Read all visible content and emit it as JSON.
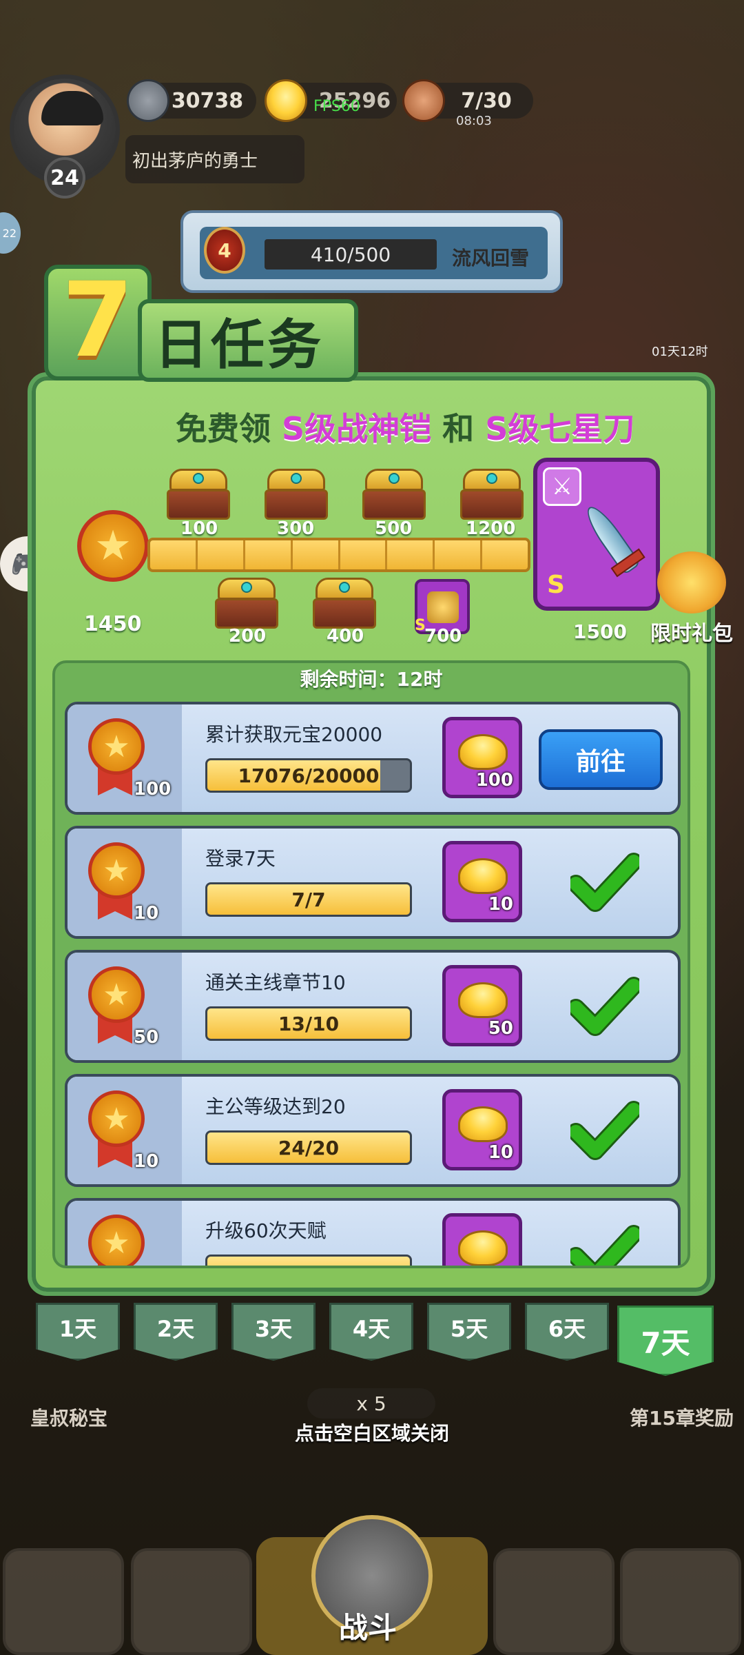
{
  "hud": {
    "level": "24",
    "title": "初出茅庐的勇士",
    "coins": "30738",
    "gold": "25296",
    "fps": "FPS60",
    "stamina": "7/30",
    "stamina_timer": "08:03",
    "side_badge": "22"
  },
  "event": {
    "level": "4",
    "progress": "410/500",
    "name": "流风回雪",
    "side_timer": "01天12时"
  },
  "modal": {
    "title_number": "7",
    "title_text": "日任务",
    "promo_prefix": "免费领",
    "promo_item1": "S级战神铠",
    "promo_and": "和",
    "promo_item2": "S级七星刀",
    "points_total": "1450",
    "milestones_top": [
      "100",
      "300",
      "500",
      "1200"
    ],
    "milestones_bottom": [
      "200",
      "400",
      "700"
    ],
    "milestone_grade_small": "S",
    "big_reward_grade": "S",
    "big_reward_value": "1500",
    "gift_label": "限时礼包",
    "remaining": "剩余时间：12时"
  },
  "tasks": [
    {
      "name": "累计获取元宝20000",
      "progress": "17076/20000",
      "progress_fraction": 0.8538,
      "points": "100",
      "reward": "100",
      "state": "go",
      "button_label": "前往"
    },
    {
      "name": "登录7天",
      "progress": "7/7",
      "progress_fraction": 1.0,
      "points": "10",
      "reward": "10",
      "state": "done"
    },
    {
      "name": "通关主线章节10",
      "progress": "13/10",
      "progress_fraction": 1.0,
      "points": "50",
      "reward": "50",
      "state": "done"
    },
    {
      "name": "主公等级达到20",
      "progress": "24/20",
      "progress_fraction": 1.0,
      "points": "10",
      "reward": "10",
      "state": "done"
    },
    {
      "name": "升级60次天赋",
      "progress": "",
      "progress_fraction": 1.0,
      "points": "",
      "reward": "",
      "state": "done"
    }
  ],
  "days": [
    "1天",
    "2天",
    "3天",
    "4天",
    "5天",
    "6天",
    "7天"
  ],
  "active_day": "7天",
  "background": {
    "left_label": "皇叔秘宝",
    "right_label": "第15章奖励",
    "battle_cost": "x 5",
    "close_hint": "点击空白区域关闭",
    "battle_label": "战斗"
  },
  "colors": {
    "panel_green": "#8fcc62",
    "reward_purple": "#b044cf",
    "go_blue": "#1d6fd6",
    "check_green": "#2fb81e",
    "promo_pink": "#d33dd6"
  }
}
